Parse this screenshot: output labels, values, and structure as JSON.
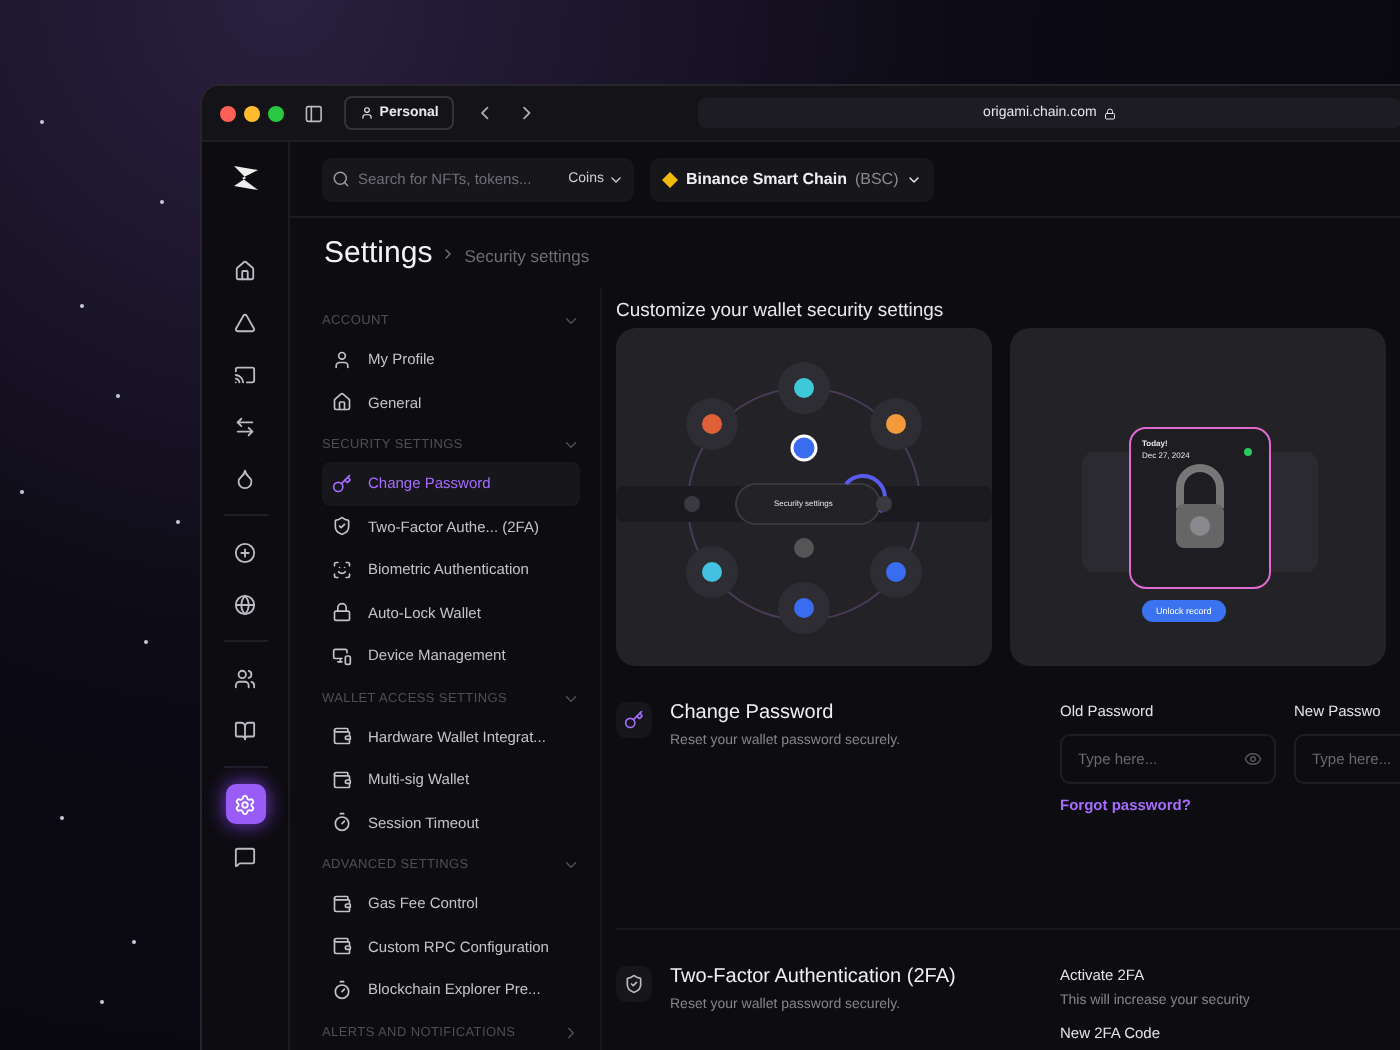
{
  "browser": {
    "profile": "Personal",
    "url": "origami.chain.com"
  },
  "rail": [
    {
      "kind": "home",
      "selected": false
    },
    {
      "kind": "shapes",
      "selected": false
    },
    {
      "kind": "cast",
      "selected": false
    },
    {
      "kind": "swap",
      "selected": false
    },
    {
      "kind": "drop",
      "selected": false
    },
    {
      "kind": "plus",
      "selected": false
    },
    {
      "kind": "globe",
      "selected": false
    },
    {
      "kind": "users",
      "selected": false
    },
    {
      "kind": "book",
      "selected": false
    },
    {
      "kind": "settings",
      "selected": true
    },
    {
      "kind": "chat",
      "selected": false
    }
  ],
  "topbar": {
    "search_placeholder": "Search for NFTs, tokens...",
    "filter": "Coins",
    "network": "Binance Smart Chain",
    "network_suffix": "(BSC)"
  },
  "header": {
    "title": "Settings",
    "breadcrumb": "Security settings"
  },
  "nav": [
    {
      "title": "ACCOUNT",
      "expanded": true,
      "items": [
        {
          "label": "My Profile",
          "kind": "user",
          "selected": false
        },
        {
          "label": "General",
          "kind": "home",
          "selected": false
        }
      ]
    },
    {
      "title": "SECURITY SETTINGS",
      "expanded": true,
      "items": [
        {
          "label": "Change Password",
          "kind": "key",
          "selected": true
        },
        {
          "label": "Two-Factor Authe... (2FA)",
          "kind": "shield",
          "selected": false
        },
        {
          "label": "Biometric Authentication",
          "kind": "scan",
          "selected": false
        },
        {
          "label": "Auto-Lock Wallet",
          "kind": "lock",
          "selected": false
        },
        {
          "label": "Device Management",
          "kind": "device",
          "selected": false
        }
      ]
    },
    {
      "title": "WALLET ACCESS SETTINGS",
      "expanded": true,
      "items": [
        {
          "label": "Hardware Wallet Integrat...",
          "kind": "wallet",
          "selected": false
        },
        {
          "label": "Multi-sig Wallet",
          "kind": "wallet",
          "selected": false
        },
        {
          "label": "Session Timeout",
          "kind": "timer",
          "selected": false
        }
      ]
    },
    {
      "title": "ADVANCED SETTINGS",
      "expanded": true,
      "items": [
        {
          "label": "Gas Fee Control",
          "kind": "wallet",
          "selected": false
        },
        {
          "label": "Custom RPC Configuration",
          "kind": "wallet",
          "selected": false
        },
        {
          "label": "Blockchain Explorer Pre...",
          "kind": "timer",
          "selected": false
        }
      ]
    },
    {
      "title": "ALERTS AND NOTIFICATIONS",
      "expanded": false
    }
  ],
  "intro": {
    "title": "Customize your wallet security settings",
    "hub_label": "Security settings",
    "card_title": "Today!",
    "card_date": "Dec 27, 2024",
    "unlock": "Unlock record"
  },
  "sections": [
    {
      "kind": "password",
      "title": "Change Password",
      "description": "Reset your wallet password securely.",
      "fields": [
        {
          "label": "Old Password",
          "placeholder": "Type here..."
        },
        {
          "label": "New Passwo",
          "placeholder": "Type here..."
        }
      ],
      "link": "Forgot password?"
    },
    {
      "kind": "twofa",
      "title": "Two-Factor Authentication (2FA)",
      "description": "Reset your wallet password securely.",
      "heading": "Activate 2FA",
      "note": "This will increase your security",
      "next_label": "New 2FA Code"
    }
  ]
}
